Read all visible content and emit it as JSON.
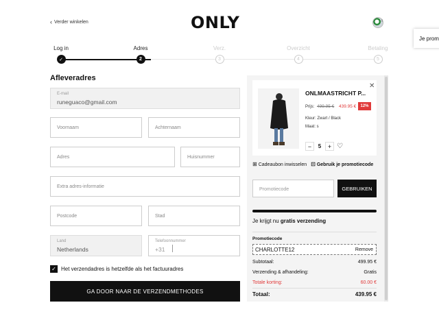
{
  "header": {
    "back_label": "Verder winkelen",
    "logo": "ONLY",
    "side_tab": "Je prom"
  },
  "steps": [
    {
      "label": "Log in",
      "marker": "✓",
      "state": "done"
    },
    {
      "label": "Adres",
      "marker": "2",
      "state": "current"
    },
    {
      "label": "Verz.",
      "marker": "3",
      "state": "upcoming"
    },
    {
      "label": "Overzicht",
      "marker": "4",
      "state": "upcoming"
    },
    {
      "label": "Betaling",
      "marker": "5",
      "state": "upcoming"
    }
  ],
  "form": {
    "title": "Afleveradres",
    "email_label": "E-mail",
    "email_value": "runeguaco@gmail.com",
    "firstname_placeholder": "Voornaam",
    "lastname_placeholder": "Achternaam",
    "address_placeholder": "Adres",
    "housenumber_placeholder": "Huisnummer",
    "extra_placeholder": "Extra adres-informatie",
    "postcode_placeholder": "Postcode",
    "city_placeholder": "Stad",
    "country_label": "Land",
    "country_value": "Netherlands",
    "phone_label": "Telefoonnummer",
    "phone_prefix": "+31",
    "same_address_label": "Het verzendadres is hetzelfde als het factuuradres",
    "continue_button": "GA DOOR NAAR DE VERZENDMETHODES"
  },
  "cart": {
    "product_name": "ONLMAASTRICHT P...",
    "price_label": "Prijs:",
    "old_price": "499.95 €",
    "new_price": "439.95 €",
    "discount_badge": "12%",
    "color_line": "Kleur: Zwart / Black",
    "size_line": "Maat: s",
    "quantity": "5",
    "giftcard_link": "Cadeaubon inwisselen",
    "promo_link": "Gebruik je promotiecode",
    "promo_placeholder": "Promotiecode",
    "apply_button": "GEBRUIKEN",
    "shipping_prefix": "Je krijgt nu ",
    "shipping_bold": "gratis verzending",
    "promo_heading": "Promotiecode",
    "promo_code": "CHARLOTTE12",
    "remove_label": "Remove",
    "subtotal_label": "Subtotaal:",
    "subtotal_value": "499.95 €",
    "shipping_label": "Verzending & afhandeling:",
    "shipping_value": "Gratis",
    "discount_label": "Totale korting:",
    "discount_value": "60.00 €",
    "total_label": "Totaal:",
    "total_value": "439.95 €"
  }
}
